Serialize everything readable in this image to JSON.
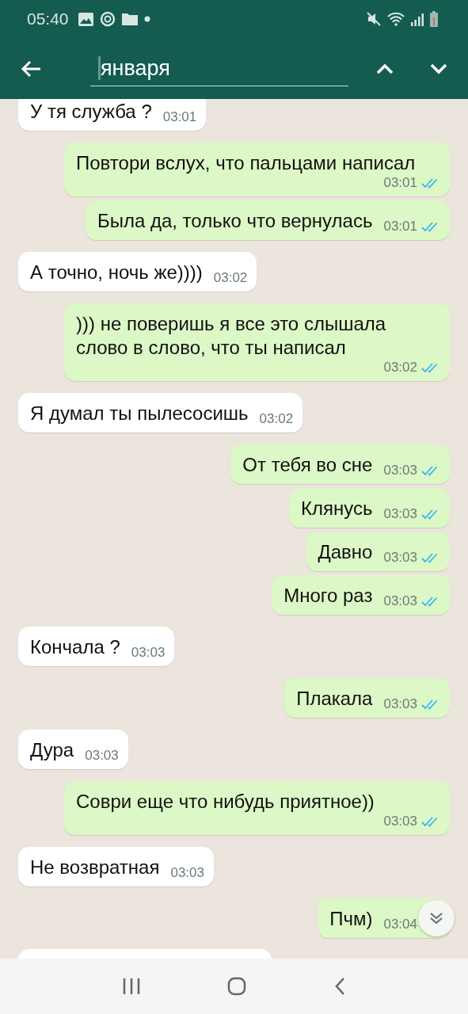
{
  "status_bar": {
    "time": "05:40"
  },
  "search": {
    "value": "января"
  },
  "messages": [
    {
      "kind": "in",
      "text": "У тя служба ?",
      "time": "03:01"
    },
    {
      "kind": "out",
      "text": "Повтори вслух, что пальцами написал",
      "time": "03:01",
      "read": true
    },
    {
      "kind": "out",
      "text": "Была да, только что вернулась",
      "time": "03:01",
      "read": true
    },
    {
      "kind": "in",
      "text": "А точно, ночь же))))",
      "time": "03:02"
    },
    {
      "kind": "out",
      "text": "))) не поверишь я все это слышала слово в слово, что ты написал",
      "time": "03:02",
      "read": true
    },
    {
      "kind": "in",
      "text": "Я думал ты пылесосишь",
      "time": "03:02"
    },
    {
      "kind": "out",
      "text": "От тебя во сне",
      "time": "03:03",
      "read": true
    },
    {
      "kind": "out",
      "text": "Клянусь",
      "time": "03:03",
      "read": true
    },
    {
      "kind": "out",
      "text": "Давно",
      "time": "03:03",
      "read": true
    },
    {
      "kind": "out",
      "text": "Много раз",
      "time": "03:03",
      "read": true
    },
    {
      "kind": "in",
      "text": "Кончала ?",
      "time": "03:03"
    },
    {
      "kind": "out",
      "text": "Плакала",
      "time": "03:03",
      "read": true
    },
    {
      "kind": "in",
      "text": "Дура",
      "time": "03:03"
    },
    {
      "kind": "out",
      "text": "Соври еще что нибудь приятное))",
      "time": "03:03",
      "read": true
    },
    {
      "kind": "in",
      "text": "Не возвратная",
      "time": "03:03"
    },
    {
      "kind": "out",
      "text": "Пчм)",
      "time": "03:04"
    }
  ]
}
